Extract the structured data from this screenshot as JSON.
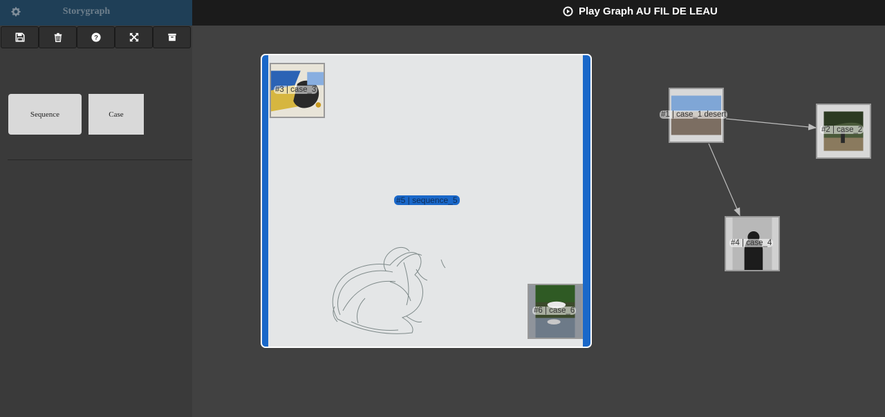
{
  "sidebar": {
    "title": "Storygraph",
    "gear_icon": "gear-icon",
    "toolbar": [
      {
        "icon": "save-icon"
      },
      {
        "icon": "trash-icon"
      },
      {
        "icon": "help-icon"
      },
      {
        "icon": "fullscreen-icon"
      },
      {
        "icon": "archive-icon"
      }
    ],
    "node_types": {
      "sequence": "Sequence",
      "case": "Case"
    }
  },
  "topbar": {
    "play_label": "Play Graph AU FIL DE LEAU"
  },
  "graph": {
    "sequence": {
      "label": "#5 | sequence_5"
    },
    "nodes": {
      "case_3": "#3 | case_3",
      "case_6": "#6 | case_6",
      "case_1": "#1 | case_1 desert",
      "case_2": "#2 | case_2",
      "case_4": "#4 | case_4"
    }
  },
  "colors": {
    "sidebar_header": "#1f3f57",
    "sequence_accent": "#1a68c9",
    "canvas": "#414141"
  }
}
